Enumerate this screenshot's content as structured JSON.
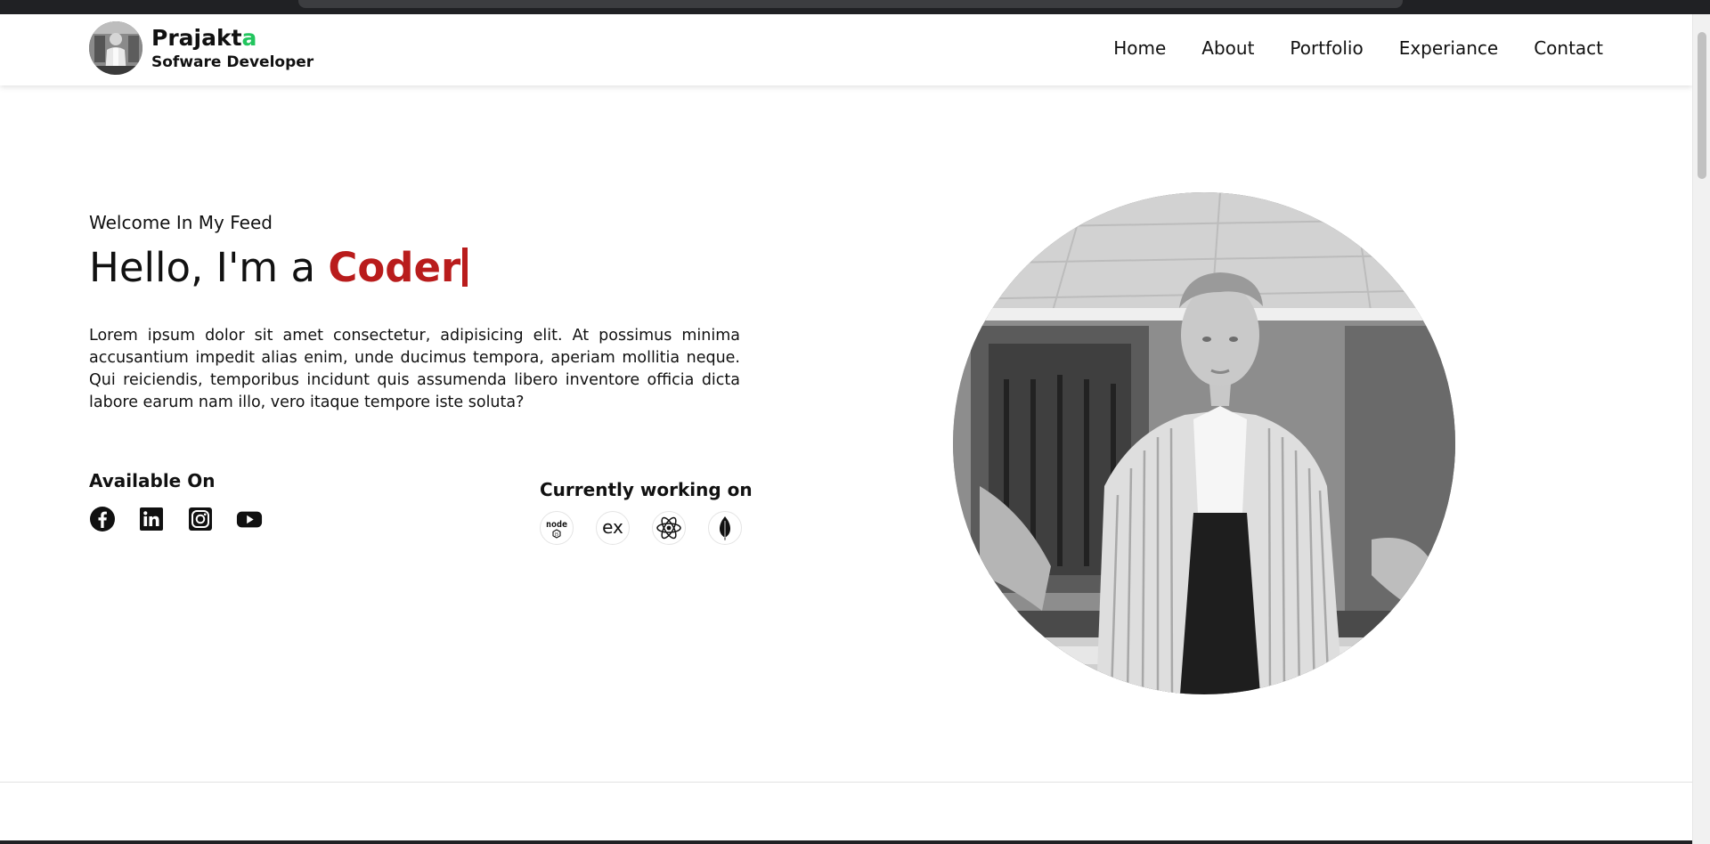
{
  "brand": {
    "name_main": "Prajakt",
    "name_accent": "a",
    "role": "Sofware Developer",
    "accent_color": "#22c55e"
  },
  "nav": {
    "items": [
      {
        "label": "Home"
      },
      {
        "label": "About"
      },
      {
        "label": "Portfolio"
      },
      {
        "label": "Experiance"
      },
      {
        "label": "Contact"
      }
    ]
  },
  "hero": {
    "welcome": "Welcome In My Feed",
    "greeting": "Hello, I'm a",
    "role": "Coder",
    "role_color": "#b91c1c",
    "description": "Lorem ipsum dolor sit amet consectetur, adipisicing elit. At possimus minima accusantium impedit alias enim, unde ducimus tempora, aperiam mollitia neque. Qui reiciendis, temporibus incidunt quis assumenda libero inventore officia dicta labore earum nam illo, vero itaque tempore iste soluta?"
  },
  "available": {
    "title": "Available On",
    "icons": [
      "facebook-icon",
      "linkedin-icon",
      "instagram-icon",
      "youtube-icon"
    ]
  },
  "working": {
    "title": "Currently working on",
    "icons": [
      "nodejs-icon",
      "express-icon",
      "react-icon",
      "mongodb-icon"
    ]
  }
}
